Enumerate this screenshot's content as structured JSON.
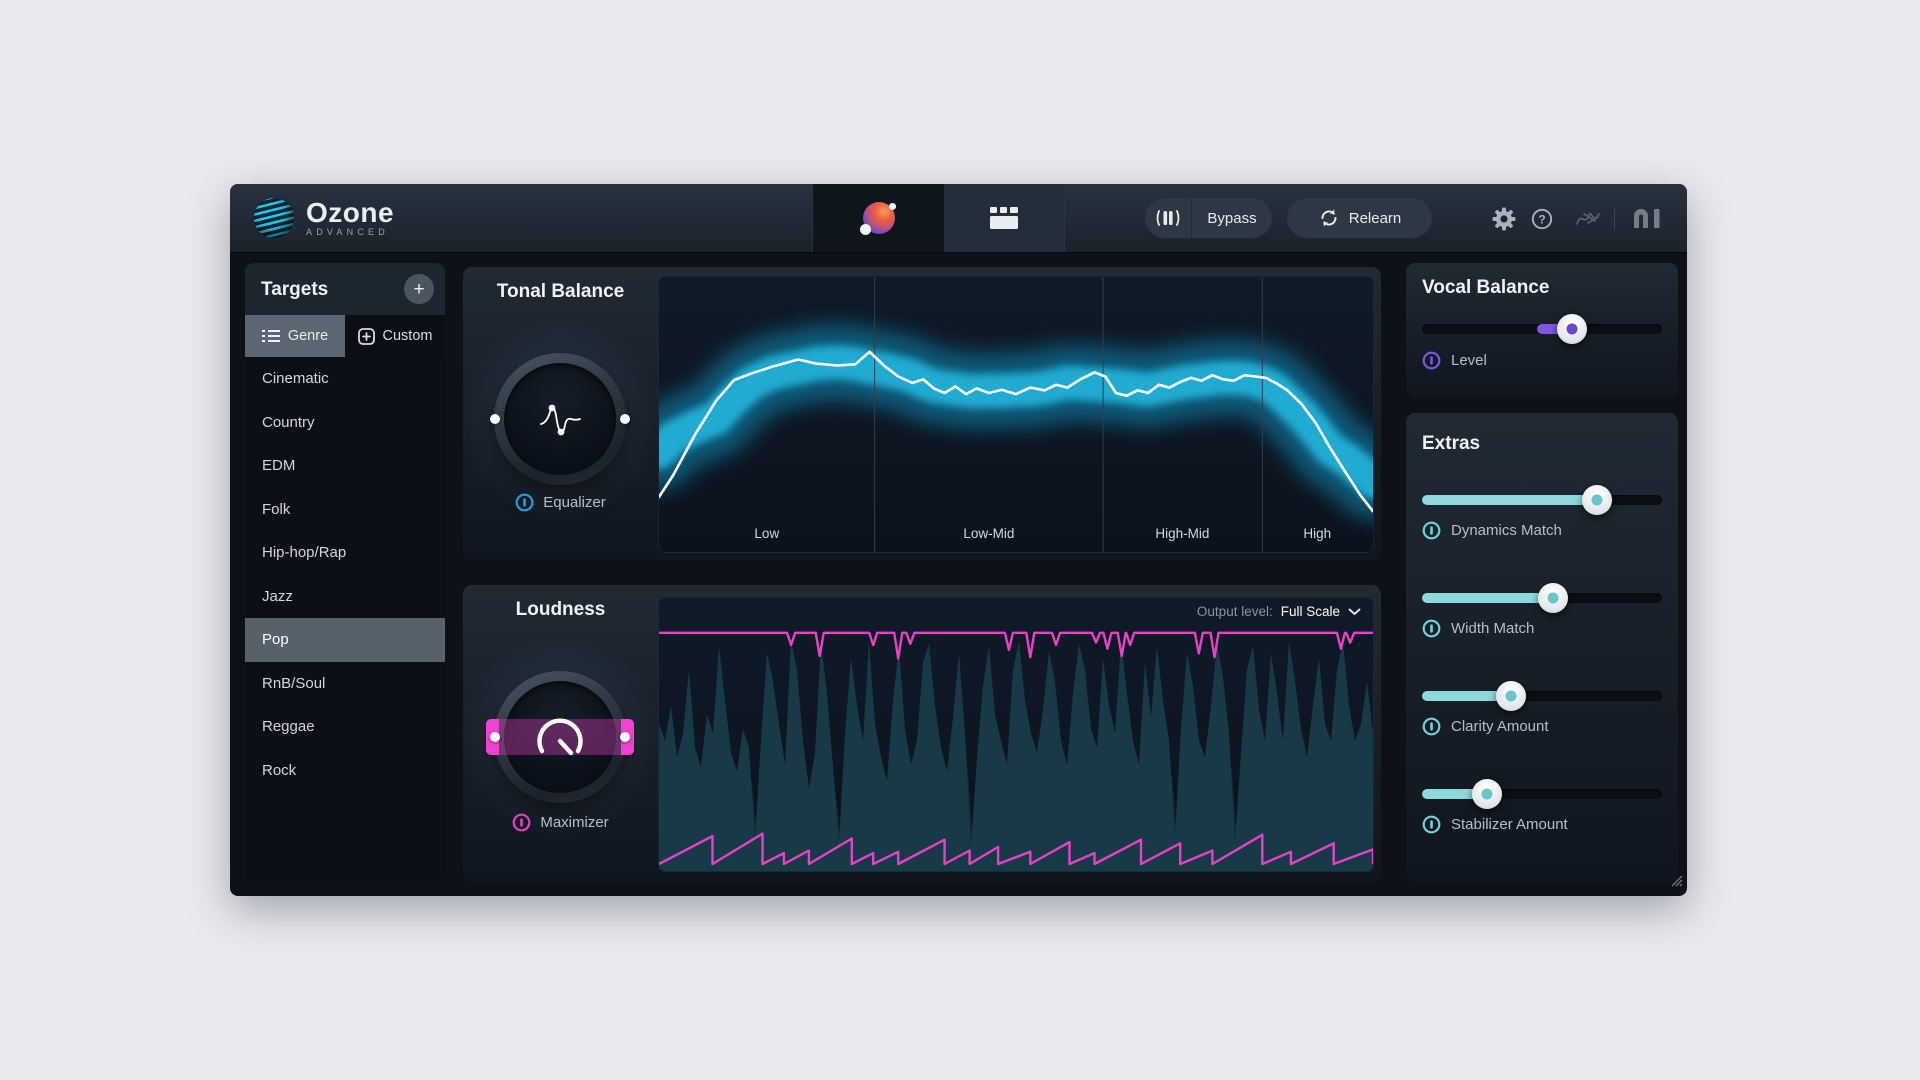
{
  "app": {
    "name": "Ozone",
    "edition": "ADVANCED"
  },
  "topbar": {
    "bypass_label": "Bypass",
    "relearn_label": "Relearn",
    "view_tabs": [
      "master-sphere-view",
      "modules-view"
    ],
    "right_icons": [
      "gear-icon",
      "help-icon",
      "history-scribble-icon",
      "ni-logo"
    ]
  },
  "targets": {
    "title": "Targets",
    "add_button": "+",
    "tabs": [
      {
        "label": "Genre",
        "icon": "list-icon",
        "active": true
      },
      {
        "label": "Custom",
        "icon": "add-square-icon",
        "active": false
      }
    ],
    "genres": [
      "Cinematic",
      "Country",
      "EDM",
      "Folk",
      "Hip-hop/Rap",
      "Jazz",
      "Pop",
      "RnB/Soul",
      "Reggae",
      "Rock"
    ],
    "selected_genre": "Pop"
  },
  "tonal_balance": {
    "title": "Tonal Balance",
    "module_label": "Equalizer"
  },
  "loudness": {
    "title": "Loudness",
    "module_label": "Maximizer",
    "output_level_label": "Output level:",
    "output_level_value": "Full Scale"
  },
  "vocal_balance": {
    "title": "Vocal Balance",
    "slider": {
      "label": "Level",
      "value_pct": 62.5,
      "center_pct": 48
    }
  },
  "extras": {
    "title": "Extras",
    "sliders": [
      {
        "label": "Dynamics Match",
        "value_pct": 73
      },
      {
        "label": "Width Match",
        "value_pct": 54.5
      },
      {
        "label": "Clarity Amount",
        "value_pct": 37
      },
      {
        "label": "Stabilizer Amount",
        "value_pct": 27
      }
    ]
  },
  "colors": {
    "teal_accent": "#8fd8dc",
    "teal_icon": "#6fd3d9",
    "teal_dot": "#6bc3cb",
    "purple_accent": "#7e57e4",
    "purple_dot": "#6a44c9",
    "blue_eq": "#1f9fe0",
    "pink_max": "#e33fc3",
    "magenta": "#e741c8",
    "band_cyan": "#18b4e2",
    "waveform_teal": "#183a46",
    "chart_bg": "#0c1420"
  },
  "chart_data": [
    {
      "type": "area",
      "name": "tonal-balance-spectrum",
      "title": "Tonal Balance",
      "categories": [
        "Low",
        "Low-Mid",
        "High-Mid",
        "High"
      ],
      "category_centers": [
        0.151,
        0.462,
        0.733,
        0.922
      ],
      "dividers": [
        0.302,
        0.622,
        0.845
      ],
      "band_color": "#18b4e2",
      "spectrum_color": "#ffffff",
      "curve": [
        [
          0,
          0.8
        ],
        [
          0.02,
          0.72
        ],
        [
          0.05,
          0.575
        ],
        [
          0.08,
          0.45
        ],
        [
          0.105,
          0.375
        ],
        [
          0.13,
          0.35
        ],
        [
          0.16,
          0.325
        ],
        [
          0.195,
          0.3
        ],
        [
          0.22,
          0.315
        ],
        [
          0.25,
          0.322
        ],
        [
          0.275,
          0.317
        ],
        [
          0.295,
          0.272
        ],
        [
          0.315,
          0.322
        ],
        [
          0.335,
          0.362
        ],
        [
          0.355,
          0.385
        ],
        [
          0.37,
          0.372
        ],
        [
          0.385,
          0.405
        ],
        [
          0.4,
          0.422
        ],
        [
          0.415,
          0.398
        ],
        [
          0.43,
          0.426
        ],
        [
          0.445,
          0.405
        ],
        [
          0.462,
          0.422
        ],
        [
          0.48,
          0.41
        ],
        [
          0.5,
          0.426
        ],
        [
          0.52,
          0.402
        ],
        [
          0.54,
          0.412
        ],
        [
          0.556,
          0.392
        ],
        [
          0.572,
          0.402
        ],
        [
          0.59,
          0.372
        ],
        [
          0.61,
          0.347
        ],
        [
          0.625,
          0.362
        ],
        [
          0.64,
          0.422
        ],
        [
          0.655,
          0.432
        ],
        [
          0.67,
          0.412
        ],
        [
          0.685,
          0.422
        ],
        [
          0.7,
          0.392
        ],
        [
          0.715,
          0.402
        ],
        [
          0.73,
          0.382
        ],
        [
          0.745,
          0.367
        ],
        [
          0.76,
          0.377
        ],
        [
          0.775,
          0.357
        ],
        [
          0.79,
          0.372
        ],
        [
          0.805,
          0.377
        ],
        [
          0.82,
          0.357
        ],
        [
          0.835,
          0.362
        ],
        [
          0.85,
          0.367
        ],
        [
          0.865,
          0.387
        ],
        [
          0.88,
          0.412
        ],
        [
          0.9,
          0.462
        ],
        [
          0.92,
          0.532
        ],
        [
          0.94,
          0.622
        ],
        [
          0.962,
          0.712
        ],
        [
          0.982,
          0.792
        ],
        [
          1.0,
          0.852
        ]
      ]
    },
    {
      "type": "area",
      "name": "loudness-history",
      "threshold_color": "#e741c8",
      "waveform_color": "#183a46",
      "threshold_y": 0.02,
      "threshold_dips": [
        [
          0.185,
          0.05
        ],
        [
          0.225,
          0.095
        ],
        [
          0.3,
          0.05
        ],
        [
          0.335,
          0.105
        ],
        [
          0.352,
          0.045
        ],
        [
          0.49,
          0.07
        ],
        [
          0.52,
          0.1
        ],
        [
          0.556,
          0.05
        ],
        [
          0.612,
          0.04
        ],
        [
          0.628,
          0.065
        ],
        [
          0.648,
          0.095
        ],
        [
          0.66,
          0.05
        ],
        [
          0.756,
          0.085
        ],
        [
          0.778,
          0.1
        ],
        [
          0.955,
          0.065
        ],
        [
          0.968,
          0.04
        ]
      ],
      "gain_reduction": [
        [
          0.0,
          0.075,
          0.115
        ],
        [
          0.075,
          0.145,
          0.125
        ],
        [
          0.145,
          0.175,
          0.045
        ],
        [
          0.175,
          0.21,
          0.055
        ],
        [
          0.21,
          0.27,
          0.105
        ],
        [
          0.27,
          0.3,
          0.045
        ],
        [
          0.3,
          0.335,
          0.05
        ],
        [
          0.335,
          0.4,
          0.1
        ],
        [
          0.4,
          0.435,
          0.055
        ],
        [
          0.435,
          0.475,
          0.07
        ],
        [
          0.475,
          0.52,
          0.05
        ],
        [
          0.52,
          0.575,
          0.09
        ],
        [
          0.575,
          0.61,
          0.045
        ],
        [
          0.61,
          0.675,
          0.1
        ],
        [
          0.675,
          0.73,
          0.085
        ],
        [
          0.73,
          0.775,
          0.055
        ],
        [
          0.775,
          0.845,
          0.12
        ],
        [
          0.845,
          0.885,
          0.05
        ],
        [
          0.885,
          0.945,
          0.085
        ],
        [
          0.945,
          1.0,
          0.06
        ]
      ],
      "waveform": [
        0.62,
        0.55,
        0.7,
        0.48,
        0.58,
        0.85,
        0.52,
        0.44,
        0.66,
        0.58,
        0.95,
        0.72,
        0.5,
        0.42,
        0.6,
        0.52,
        0.14,
        0.55,
        0.92,
        0.8,
        0.62,
        0.45,
        0.97,
        0.85,
        0.55,
        0.35,
        0.5,
        0.96,
        0.75,
        0.44,
        0.12,
        0.58,
        0.9,
        0.7,
        0.55,
        0.97,
        0.62,
        0.48,
        0.38,
        0.72,
        0.94,
        0.6,
        0.45,
        0.55,
        0.88,
        0.96,
        0.7,
        0.52,
        0.42,
        0.65,
        0.92,
        0.58,
        0.1,
        0.48,
        0.78,
        0.95,
        0.66,
        0.55,
        0.45,
        0.85,
        0.97,
        0.72,
        0.58,
        0.5,
        0.68,
        0.93,
        0.8,
        0.55,
        0.45,
        0.75,
        0.96,
        0.85,
        0.6,
        0.52,
        0.9,
        0.7,
        0.58,
        0.97,
        0.75,
        0.55,
        0.45,
        0.88,
        0.65,
        0.95,
        0.72,
        0.55,
        0.15,
        0.6,
        0.92,
        0.78,
        0.55,
        0.48,
        0.7,
        0.96,
        0.82,
        0.58,
        0.12,
        0.5,
        0.85,
        0.95,
        0.68,
        0.55,
        0.92,
        0.75,
        0.55,
        0.97,
        0.8,
        0.6,
        0.48,
        0.7,
        0.9,
        0.62,
        0.55,
        0.85,
        0.97,
        0.7,
        0.55,
        0.62,
        0.8,
        0.58
      ]
    }
  ]
}
